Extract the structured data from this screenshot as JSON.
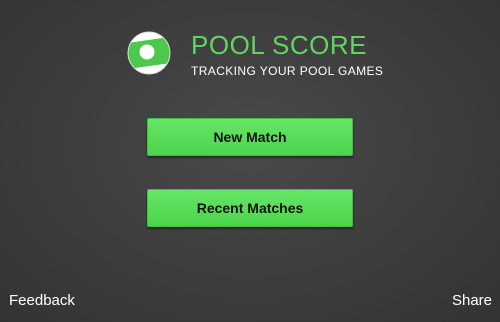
{
  "header": {
    "logo_icon": "pool-ball-logo-icon",
    "title": "POOL SCORE",
    "subtitle": "TRACKING YOUR POOL GAMES"
  },
  "main": {
    "new_match_label": "New Match",
    "recent_matches_label": "Recent Matches"
  },
  "footer": {
    "feedback_label": "Feedback",
    "share_label": "Share"
  },
  "colors": {
    "accent": "#5fd65f",
    "button": "#55dd55",
    "background": "#404040"
  }
}
